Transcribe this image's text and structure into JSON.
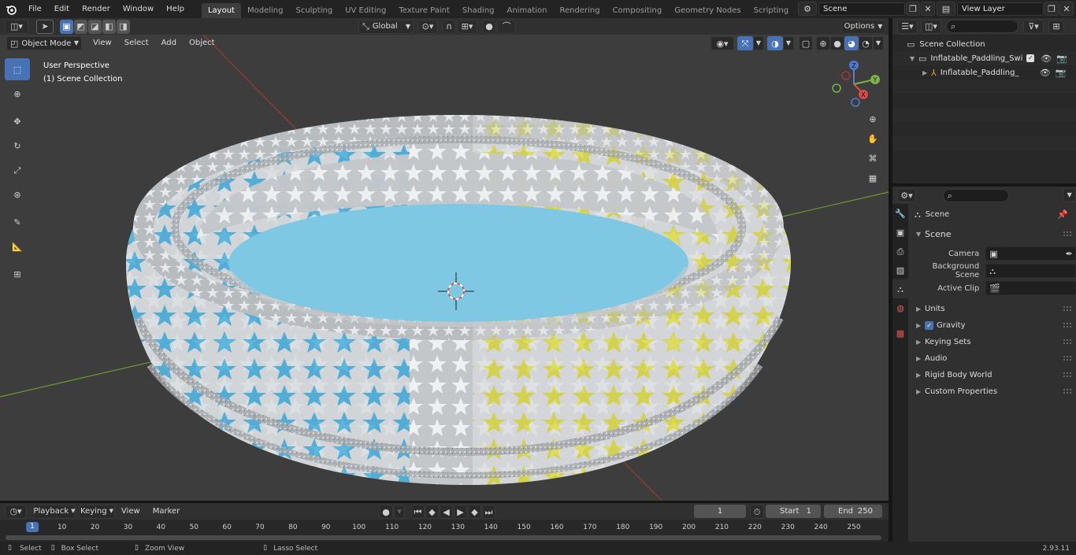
{
  "topbar": {
    "menus": [
      "File",
      "Edit",
      "Render",
      "Window",
      "Help"
    ],
    "workspaces": [
      "Layout",
      "Modeling",
      "Sculpting",
      "UV Editing",
      "Texture Paint",
      "Shading",
      "Animation",
      "Rendering",
      "Compositing",
      "Geometry Nodes",
      "Scripting"
    ],
    "active_workspace": "Layout",
    "scene_name": "Scene",
    "view_layer": "View Layer"
  },
  "viewport_header": {
    "mode": "Object Mode",
    "menus": [
      "View",
      "Select",
      "Add",
      "Object"
    ],
    "orientation": "Global",
    "options_label": "Options"
  },
  "viewport": {
    "overlay_line1": "User Perspective",
    "overlay_line2": "(1) Scene Collection",
    "gizmo": {
      "z": "Z",
      "y": "Y",
      "x": "X"
    },
    "colors": {
      "background": "#3d3d3d",
      "x_axis": "#a03838",
      "y_axis": "#6a9a2a",
      "pool_water": "#7ec8e3",
      "star_blue": "#2ba4d8",
      "star_yellow": "#d8d624"
    }
  },
  "outliner": {
    "root": "Scene Collection",
    "items": [
      {
        "label": "Inflatable_Paddling_Swimmin"
      },
      {
        "label": "Inflatable_Paddling_Swim"
      }
    ]
  },
  "properties": {
    "context_label": "Scene",
    "section_title": "Scene",
    "fields": [
      {
        "label": "Camera"
      },
      {
        "label": "Background Scene"
      },
      {
        "label": "Active Clip"
      }
    ],
    "panels": [
      "Units",
      "Gravity",
      "Keying Sets",
      "Audio",
      "Rigid Body World",
      "Custom Properties"
    ],
    "gravity_checked": true
  },
  "timeline": {
    "menus": [
      "Playback",
      "Keying",
      "View",
      "Marker"
    ],
    "current_frame": "1",
    "start_label": "Start",
    "start_value": "1",
    "end_label": "End",
    "end_value": "250",
    "ticks": [
      "1",
      "10",
      "20",
      "30",
      "40",
      "50",
      "60",
      "70",
      "80",
      "90",
      "100",
      "110",
      "120",
      "130",
      "140",
      "150",
      "160",
      "170",
      "180",
      "190",
      "200",
      "210",
      "220",
      "230",
      "240",
      "250"
    ]
  },
  "statusbar": {
    "hints": [
      "Select",
      "Box Select",
      "Zoom View",
      "Lasso Select"
    ],
    "version": "2.93.11"
  }
}
